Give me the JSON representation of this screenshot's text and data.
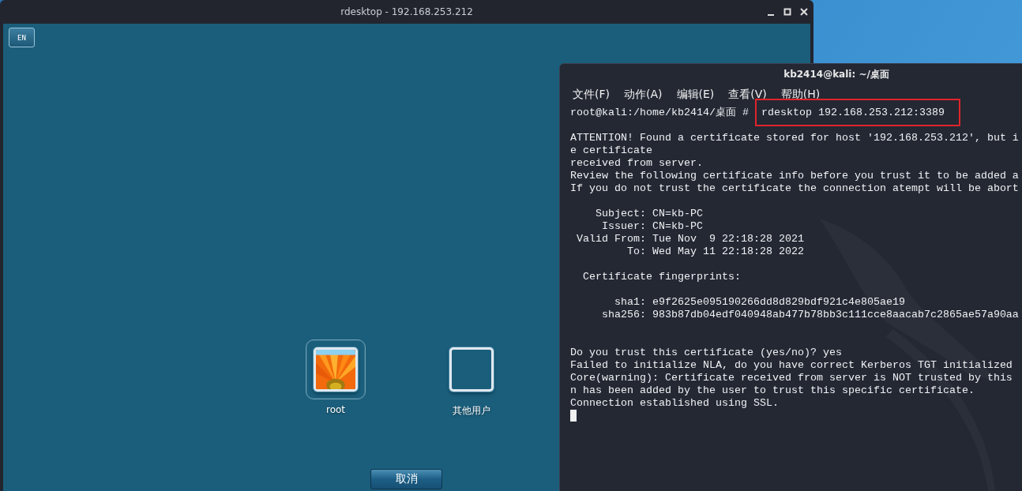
{
  "rdesktop_window": {
    "title": "rdesktop - 192.168.253.212",
    "login_screen": {
      "language_button": "EN",
      "users": [
        {
          "name": "root",
          "selected": true,
          "kind": "picture"
        },
        {
          "name": "其他用户",
          "selected": false,
          "kind": "blank"
        }
      ],
      "cancel_button": "取消"
    }
  },
  "terminal_window": {
    "title": "kb2414@kali: ~/桌面",
    "menu": [
      "文件(F)",
      "动作(A)",
      "编辑(E)",
      "查看(V)",
      "帮助(H)"
    ],
    "prompt": "root@kali:/home/kb2414/桌面 #",
    "command": "rdesktop 192.168.253.212:3389",
    "command_highlighted": true,
    "output": [
      {
        "kind": "section",
        "lines": [
          "ATTENTION! Found a certificate stored for host '192.168.253.212', but i",
          "e certificate",
          "received from server.",
          "Review the following certificate info before you trust it to be added a",
          "If you do not trust the certificate the connection atempt will be abort"
        ]
      },
      {
        "kind": "section",
        "lines": [
          "    Subject: CN=kb-PC",
          "     Issuer: CN=kb-PC",
          " Valid From: Tue Nov  9 22:18:28 2021",
          "         To: Wed May 11 22:18:28 2022"
        ]
      },
      {
        "kind": "section",
        "lines": [
          "  Certificate fingerprints:"
        ]
      },
      {
        "kind": "section",
        "lines": [
          "       sha1: e9f2625e095190266dd8d829bdf921c4e805ae19",
          "     sha256: 983b87db04edf040948ab477b78bb3c111cce8aacab7c2865ae57a90aa"
        ]
      },
      {
        "kind": "wide_section",
        "lines": [
          "Do you trust this certificate (yes/no)? yes",
          "Failed to initialize NLA, do you have correct Kerberos TGT initialized",
          "Core(warning): Certificate received from server is NOT trusted by this",
          "n has been added by the user to trust this specific certificate.",
          "Connection established using SSL."
        ]
      }
    ],
    "cursor": true
  }
}
